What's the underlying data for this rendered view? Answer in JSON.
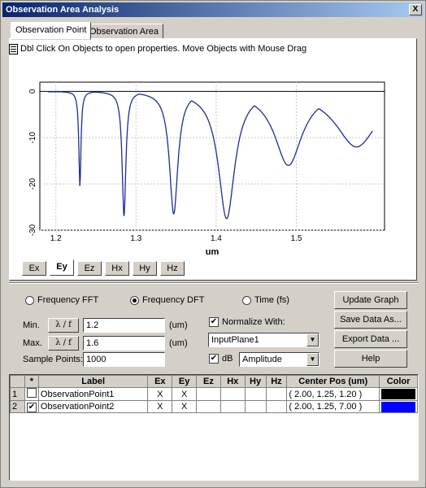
{
  "window": {
    "title": "Observation Area Analysis",
    "close_glyph": "X"
  },
  "tabs": [
    "Observation Point",
    "Observation Area"
  ],
  "hint": "Dbl Click On Objects to open properties.  Move Objects with Mouse Drag",
  "chart_data": {
    "type": "line",
    "xlabel": "um",
    "xlim": [
      1.18,
      1.61
    ],
    "ylim": [
      -30,
      2
    ],
    "x_ticks": [
      "1.2",
      "1.3",
      "1.4",
      "1.5"
    ],
    "y_ticks": [
      "0",
      "-10",
      "-20",
      "-30"
    ],
    "dips": [
      {
        "x": 1.23,
        "min": -20.5
      },
      {
        "x": 1.285,
        "min": -27
      },
      {
        "x": 1.347,
        "min": -26.5
      },
      {
        "x": 1.413,
        "min": -27.5
      },
      {
        "x": 1.49,
        "min": -16
      },
      {
        "x": 1.575,
        "min": -12
      }
    ],
    "series_color": "#1f2a9a",
    "series_end": 1.595
  },
  "field_tabs": [
    "Ex",
    "Ey",
    "Ez",
    "Hx",
    "Hy",
    "Hz"
  ],
  "modes": {
    "freq_fft": "Frequency FFT",
    "freq_dft": "Frequency DFT",
    "time": "Time (fs)"
  },
  "min_label": "Min.",
  "max_label": "Max.",
  "lambda_btn": "λ / f",
  "min_value": "1.2",
  "max_value": "1.6",
  "unit": "(um)",
  "sample_points_label": "Sample Points:",
  "sample_points_value": "1000",
  "normalize_label": "Normalize With:",
  "normalize_value": "InputPlane1",
  "db_label": "dB",
  "db_value": "Amplitude",
  "buttons": {
    "update": "Update Graph",
    "save": "Save Data As...",
    "export": "Export Data ...",
    "help": "Help"
  },
  "table": {
    "headers": [
      "*",
      "Label",
      "Ex",
      "Ey",
      "Ez",
      "Hx",
      "Hy",
      "Hz",
      "Center Pos (um)",
      "Color"
    ],
    "rows": [
      {
        "num": "1",
        "checked": false,
        "check_glyph": "",
        "label": "ObservationPoint1",
        "ex": "X",
        "ey": "X",
        "ez": "",
        "hx": "",
        "hy": "",
        "hz": "",
        "pos": "( 2.00, 1.25, 1.20 )",
        "color": "#000000"
      },
      {
        "num": "2",
        "checked": true,
        "check_glyph": "✔",
        "label": "ObservationPoint2",
        "ex": "X",
        "ey": "X",
        "ez": "",
        "hx": "",
        "hy": "",
        "hz": "",
        "pos": "( 2.00, 1.25, 7.00 )",
        "color": "#0000ff"
      }
    ]
  }
}
